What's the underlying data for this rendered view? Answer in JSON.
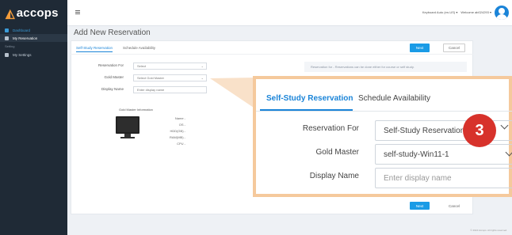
{
  "app": {
    "logo": "accops"
  },
  "sidebar": {
    "items": [
      {
        "label": "Dashboard"
      },
      {
        "label": "My Reservation"
      }
    ],
    "section_label": "Setting",
    "settings_item": "My Settings"
  },
  "topbar": {
    "keyboard": "Keyboard Auto (en-US) ▾",
    "welcome": "Welcome ab024293 ▾"
  },
  "page": {
    "title": "Add New Reservation"
  },
  "tabs": [
    "Self-Study Reservation",
    "Schedule Availability"
  ],
  "buttons": {
    "next": "Next",
    "cancel": "Cancel"
  },
  "form": {
    "reservation_for_label": "Reservation For",
    "reservation_for_value": "Select",
    "gold_master_label": "Gold Master",
    "gold_master_value": "Select Gold Master",
    "display_name_label": "Display Name",
    "display_name_placeholder": "Enter display name"
  },
  "note": "Reservation for - Reservations can be done either for course or self study.",
  "gold_master_info": {
    "title": "Gold Master Information",
    "specs": [
      "Name -",
      "OS -",
      "HDD(GB) -",
      "RAM(MB) -",
      "CPU -"
    ]
  },
  "footer": "© 2024 Accops. All rights reserved.",
  "zoom": {
    "tabs": [
      "Self-Study Reservation",
      "Schedule Availability"
    ],
    "reservation_for_label": "Reservation For",
    "reservation_for_value": "Self-Study Reservation",
    "gold_master_label": "Gold Master",
    "gold_master_value": "self-study-Win11-1",
    "display_name_label": "Display Name",
    "display_name_placeholder": "Enter display name"
  },
  "step_badge": "3",
  "colors": {
    "accent": "#1a84d8",
    "sidebar": "#1f2a36",
    "callout": "#f5c99c",
    "badge": "#d7322b"
  }
}
